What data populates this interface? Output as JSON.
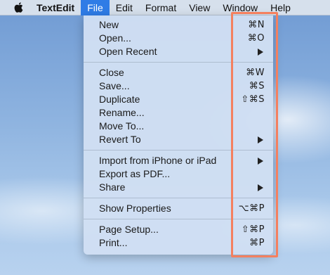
{
  "menubar": {
    "app_name": "TextEdit",
    "items": [
      "File",
      "Edit",
      "Format",
      "View",
      "Window",
      "Help"
    ]
  },
  "file_menu": {
    "new": {
      "label": "New",
      "shortcut": "⌘N"
    },
    "open": {
      "label": "Open...",
      "shortcut": "⌘O"
    },
    "open_recent": {
      "label": "Open Recent"
    },
    "close": {
      "label": "Close",
      "shortcut": "⌘W"
    },
    "save": {
      "label": "Save...",
      "shortcut": "⌘S"
    },
    "duplicate": {
      "label": "Duplicate",
      "shortcut": "⇧⌘S"
    },
    "rename": {
      "label": "Rename..."
    },
    "move_to": {
      "label": "Move To..."
    },
    "revert_to": {
      "label": "Revert To"
    },
    "import_iphone": {
      "label": "Import from iPhone or iPad"
    },
    "export_pdf": {
      "label": "Export as PDF..."
    },
    "share": {
      "label": "Share"
    },
    "show_properties": {
      "label": "Show Properties",
      "shortcut": "⌥⌘P"
    },
    "page_setup": {
      "label": "Page Setup...",
      "shortcut": "⇧⌘P"
    },
    "print": {
      "label": "Print...",
      "shortcut": "⌘P"
    }
  },
  "colors": {
    "menu_highlight": "#2f7ce6",
    "annotation_box": "#f4805f"
  }
}
